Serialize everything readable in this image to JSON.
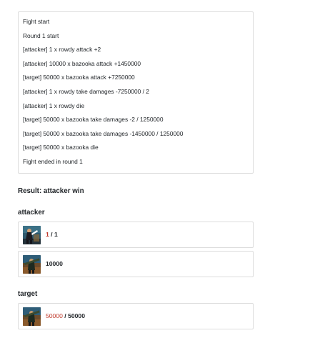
{
  "log": [
    "Fight start",
    "Round 1 start",
    "[attacker] 1 x rowdy attack +2",
    "[attacker] 10000 x bazooka attack +1450000",
    "[target] 50000 x bazooka attack +7250000",
    "[attacker] 1 x rowdy take damages -7250000 / 2",
    "[attacker] 1 x rowdy die",
    "[target] 50000 x bazooka take damages -2 / 1250000",
    "[target] 50000 x bazooka take damages -1450000 / 1250000",
    "[target] 50000 x bazooka die",
    "Fight ended in round 1"
  ],
  "result": "Result: attacker win",
  "attacker": {
    "title": "attacker",
    "units": [
      {
        "icon": "rowdy-unit-icon",
        "alive": "1",
        "separator": " / ",
        "total": "1"
      },
      {
        "icon": "bazooka-unit-icon",
        "count": "10000"
      }
    ]
  },
  "target": {
    "title": "target",
    "units": [
      {
        "icon": "bazooka-unit-icon",
        "alive": "50000",
        "separator": " / ",
        "total": "50000"
      }
    ]
  },
  "colors": {
    "border": "#dcdcdc",
    "text": "#212529",
    "alive_red": "#c0392b"
  }
}
